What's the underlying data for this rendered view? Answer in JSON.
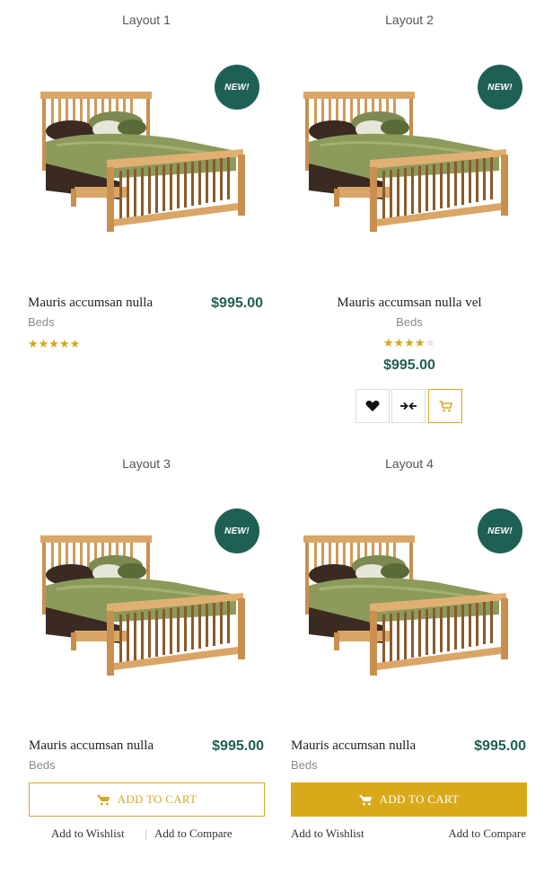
{
  "badge_label": "NEW!",
  "colors": {
    "accent_green": "#1f6055",
    "accent_gold": "#d9a91a"
  },
  "cards": [
    {
      "layout": "Layout 1",
      "name": "Mauris accumsan nulla",
      "category": "Beds",
      "price": "$995.00",
      "rating": 5
    },
    {
      "layout": "Layout 2",
      "name": "Mauris accumsan nulla vel",
      "category": "Beds",
      "price": "$995.00",
      "rating": 4
    },
    {
      "layout": "Layout 3",
      "name": "Mauris accumsan nulla",
      "category": "Beds",
      "price": "$995.00",
      "add_to_cart": "ADD TO CART",
      "wishlist": "Add to Wishlist",
      "compare": "Add to Compare"
    },
    {
      "layout": "Layout 4",
      "name": "Mauris accumsan nulla",
      "category": "Beds",
      "price": "$995.00",
      "add_to_cart": "ADD TO CART",
      "wishlist": "Add to Wishlist",
      "compare": "Add to Compare"
    }
  ],
  "icons": [
    "heart-icon",
    "compare-arrows-icon",
    "cart-icon"
  ]
}
